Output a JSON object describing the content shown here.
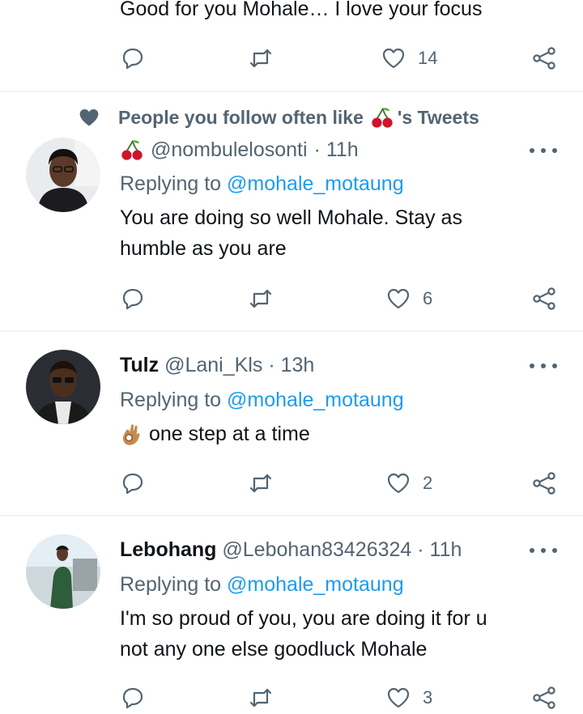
{
  "top_tweet": {
    "text": "Good for you Mohale… I love your focus",
    "likes": "14"
  },
  "social_context": {
    "text_before": "People you follow often like",
    "text_after": "'s Tweets"
  },
  "tweets": [
    {
      "display_name": "",
      "handle": "@nombulelosonti",
      "time": "· 11h",
      "replying_label": "Replying to",
      "replying_to": "@mohale_motaung",
      "text_line1": "You are doing so well Mohale. Stay as",
      "text_line2": "humble as you are",
      "likes": "6"
    },
    {
      "display_name": "Tulz",
      "handle": "@Lani_Kls",
      "time": "· 13h",
      "replying_label": "Replying to",
      "replying_to": "@mohale_motaung",
      "text_line1": "one step at a time",
      "likes": "2"
    },
    {
      "display_name": "Lebohang",
      "handle": "@Lebohan83426324",
      "time": "· 11h",
      "replying_label": "Replying to",
      "replying_to": "@mohale_motaung",
      "text_line1": "I'm so proud of you, you are doing it for u",
      "text_line2": "not any one else goodluck Mohale",
      "likes": "3"
    }
  ],
  "icons": {
    "reply": "reply-icon",
    "retweet": "retweet-icon",
    "like": "heart-icon",
    "share": "share-icon",
    "more": "more-icon",
    "social": "heart-icon",
    "cherry": "cherry-emoji",
    "ok_hand": "ok-hand-emoji"
  },
  "colors": {
    "link": "#1d9bf0",
    "muted": "#536471",
    "text": "#0f1419"
  }
}
